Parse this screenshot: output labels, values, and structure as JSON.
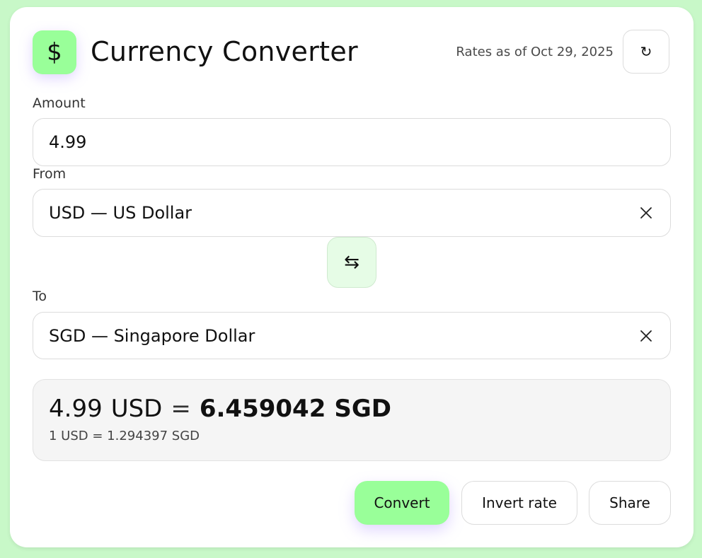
{
  "header": {
    "logo_symbol": "$",
    "title": "Currency Converter",
    "rates_text": "Rates as of Oct 29, 2025",
    "refresh_icon": "↻"
  },
  "amount": {
    "label": "Amount",
    "value": "4.99"
  },
  "from": {
    "label": "From",
    "value": "USD — US Dollar"
  },
  "to": {
    "label": "To",
    "value": "SGD — Singapore Dollar"
  },
  "swap": {
    "icon": "⇆"
  },
  "result": {
    "amount": "4.99",
    "from_code": "USD",
    "equals": "=",
    "converted": "6.459042",
    "to_code": "SGD",
    "rate_line": "1 USD = 1.294397 SGD"
  },
  "actions": {
    "convert_label": "Convert",
    "invert_label": "Invert rate",
    "share_label": "Share"
  },
  "colors": {
    "background": "#c8f8c8",
    "accent": "#99ff99",
    "swap_bg": "#e6fce6",
    "result_bg": "#f5f5f5"
  }
}
